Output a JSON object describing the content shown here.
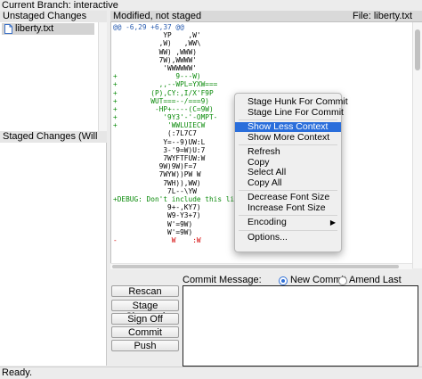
{
  "branch_label": "Current Branch: interactive",
  "unstaged": {
    "header": "Unstaged Changes",
    "files": [
      {
        "name": "liberty.txt",
        "icon": "document-icon"
      }
    ]
  },
  "staged": {
    "header": "Staged Changes (Will Commit)"
  },
  "diff": {
    "status": "Modified, not staged",
    "file_label": "File: liberty.txt",
    "lines": [
      {
        "kind": "hunk",
        "text": "@@ -6,29 +6,37 @@"
      },
      {
        "kind": "ctx",
        "text": "            YP    ,W'"
      },
      {
        "kind": "ctx",
        "text": "           ,W)   ,WW\\"
      },
      {
        "kind": "ctx",
        "text": "           WW) ,WWW)"
      },
      {
        "kind": "ctx",
        "text": "           7W),WWWW'"
      },
      {
        "kind": "ctx",
        "text": "            'WWWWWW'"
      },
      {
        "kind": "add",
        "text": "+              9---W)"
      },
      {
        "kind": "add",
        "text": "+          ,,--WPL=YXW==="
      },
      {
        "kind": "add",
        "text": "+        (P),CY:,I/X'F9P"
      },
      {
        "kind": "add",
        "text": "+        WUT===--/===9)"
      },
      {
        "kind": "add",
        "text": "+         -HP+----(C=9W)"
      },
      {
        "kind": "add",
        "text": "+           '9Y3'-'-OMPT-"
      },
      {
        "kind": "add",
        "text": "+            'WWLUIECW"
      },
      {
        "kind": "ctx",
        "text": "             (:7L7C7"
      },
      {
        "kind": "ctx",
        "text": "            Y=--9)UW:L"
      },
      {
        "kind": "ctx",
        "text": "            3-'9=W)U:7"
      },
      {
        "kind": "ctx",
        "text": "            7WYFTFUW:W"
      },
      {
        "kind": "ctx",
        "text": "           9W)9W)F=7"
      },
      {
        "kind": "ctx",
        "text": "           7WYW))PW W"
      },
      {
        "kind": "ctx",
        "text": "            7WH)),WW)"
      },
      {
        "kind": "ctx",
        "text": "             7L--\\YW"
      },
      {
        "kind": "dbg",
        "text": "+DEBUG: Don't include this line."
      },
      {
        "kind": "ctx",
        "text": "             9+-,KY7)"
      },
      {
        "kind": "ctx",
        "text": "             W9-Y3+7)"
      },
      {
        "kind": "ctx",
        "text": "             W'=9W)"
      },
      {
        "kind": "ctx",
        "text": "             W'=9W)"
      },
      {
        "kind": "del",
        "text": "-             W    :W"
      }
    ]
  },
  "context_menu": {
    "items": [
      {
        "label": "Stage Hunk For Commit",
        "name": "menu-stage-hunk"
      },
      {
        "label": "Stage Line For Commit",
        "name": "menu-stage-line"
      },
      {
        "separator": true
      },
      {
        "label": "Show Less Context",
        "name": "menu-show-less-context",
        "selected": true
      },
      {
        "label": "Show More Context",
        "name": "menu-show-more-context"
      },
      {
        "separator": true
      },
      {
        "label": "Refresh",
        "name": "menu-refresh"
      },
      {
        "label": "Copy",
        "name": "menu-copy"
      },
      {
        "label": "Select All",
        "name": "menu-select-all"
      },
      {
        "label": "Copy All",
        "name": "menu-copy-all"
      },
      {
        "separator": true
      },
      {
        "label": "Decrease Font Size",
        "name": "menu-decrease-font"
      },
      {
        "label": "Increase Font Size",
        "name": "menu-increase-font"
      },
      {
        "separator": true
      },
      {
        "label": "Encoding",
        "name": "menu-encoding",
        "submenu": true
      },
      {
        "separator": true
      },
      {
        "label": "Options...",
        "name": "menu-options"
      }
    ]
  },
  "buttons": {
    "rescan": "Rescan",
    "stage_changed": "Stage Changed",
    "sign_off": "Sign Off",
    "commit": "Commit",
    "push": "Push"
  },
  "commit": {
    "label": "Commit Message:",
    "new_commit": "New Commit",
    "amend": "Amend Last Commit",
    "mode": "new",
    "message": ""
  },
  "status": "Ready.",
  "colors": {
    "hunk": "#2a5db0",
    "added": "#0a8a0a",
    "removed": "#d40000",
    "menu_highlight": "#2a6edb"
  }
}
